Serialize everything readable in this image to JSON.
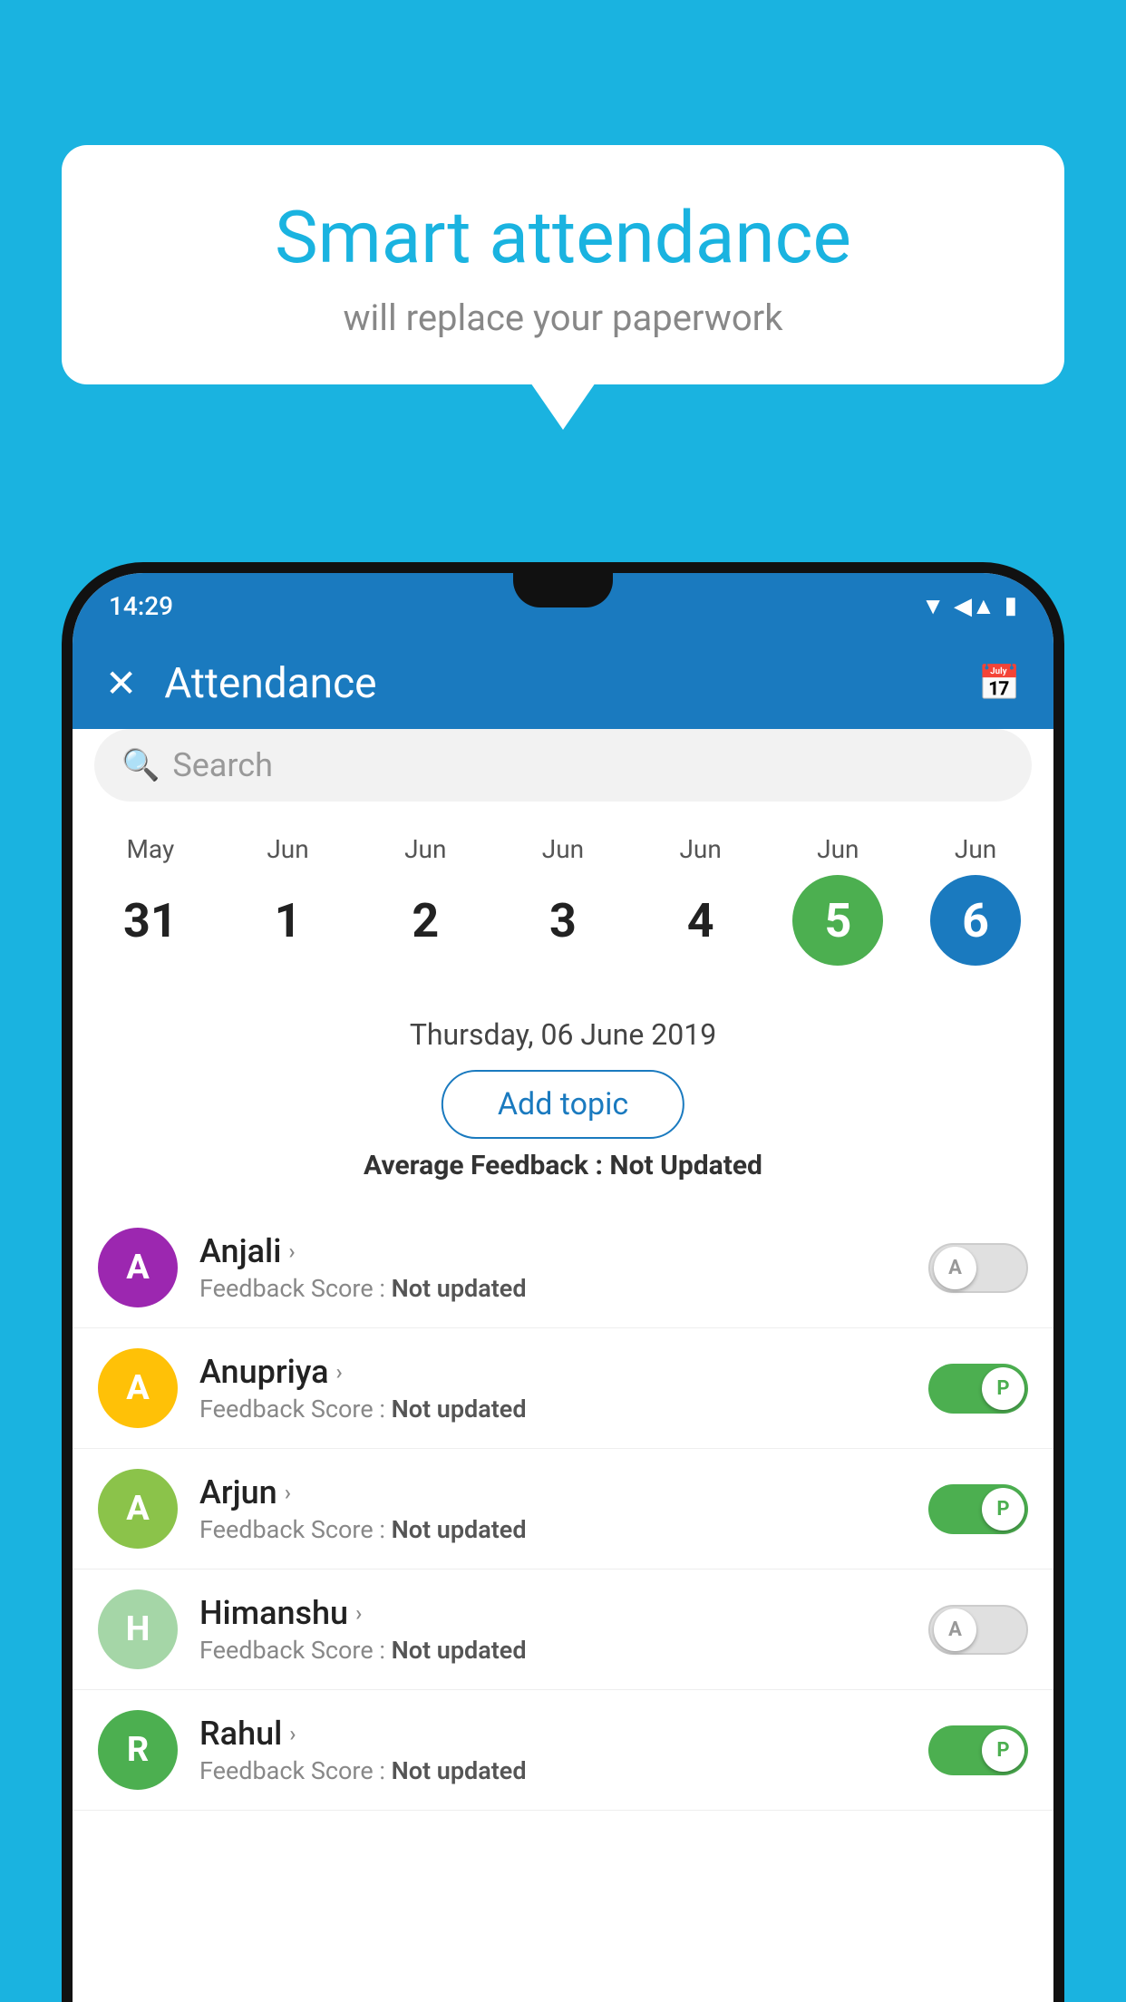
{
  "background_color": "#1ab3e0",
  "bubble": {
    "title": "Smart attendance",
    "subtitle": "will replace your paperwork"
  },
  "status_bar": {
    "time": "14:29",
    "wifi_icon": "▲",
    "signal_icon": "▲",
    "battery_icon": "▮"
  },
  "header": {
    "title": "Attendance",
    "close_label": "✕",
    "calendar_icon": "📅"
  },
  "search": {
    "placeholder": "Search"
  },
  "calendar": {
    "days": [
      {
        "month": "May",
        "date": "31",
        "style": "normal"
      },
      {
        "month": "Jun",
        "date": "1",
        "style": "normal"
      },
      {
        "month": "Jun",
        "date": "2",
        "style": "normal"
      },
      {
        "month": "Jun",
        "date": "3",
        "style": "normal"
      },
      {
        "month": "Jun",
        "date": "4",
        "style": "normal"
      },
      {
        "month": "Jun",
        "date": "5",
        "style": "today"
      },
      {
        "month": "Jun",
        "date": "6",
        "style": "selected"
      }
    ]
  },
  "selected_date": "Thursday, 06 June 2019",
  "add_topic_label": "Add topic",
  "avg_feedback_label": "Average Feedback : ",
  "avg_feedback_value": "Not Updated",
  "students": [
    {
      "name": "Anjali",
      "avatar_letter": "A",
      "avatar_color": "#9c27b0",
      "feedback_label": "Feedback Score : ",
      "feedback_value": "Not updated",
      "toggle_state": "off",
      "toggle_letter": "A"
    },
    {
      "name": "Anupriya",
      "avatar_letter": "A",
      "avatar_color": "#ffc107",
      "feedback_label": "Feedback Score : ",
      "feedback_value": "Not updated",
      "toggle_state": "on",
      "toggle_letter": "P"
    },
    {
      "name": "Arjun",
      "avatar_letter": "A",
      "avatar_color": "#8bc34a",
      "feedback_label": "Feedback Score : ",
      "feedback_value": "Not updated",
      "toggle_state": "on",
      "toggle_letter": "P"
    },
    {
      "name": "Himanshu",
      "avatar_letter": "H",
      "avatar_color": "#a5d6a7",
      "feedback_label": "Feedback Score : ",
      "feedback_value": "Not updated",
      "toggle_state": "off",
      "toggle_letter": "A"
    },
    {
      "name": "Rahul",
      "avatar_letter": "R",
      "avatar_color": "#4caf50",
      "feedback_label": "Feedback Score : ",
      "feedback_value": "Not updated",
      "toggle_state": "on",
      "toggle_letter": "P"
    }
  ]
}
